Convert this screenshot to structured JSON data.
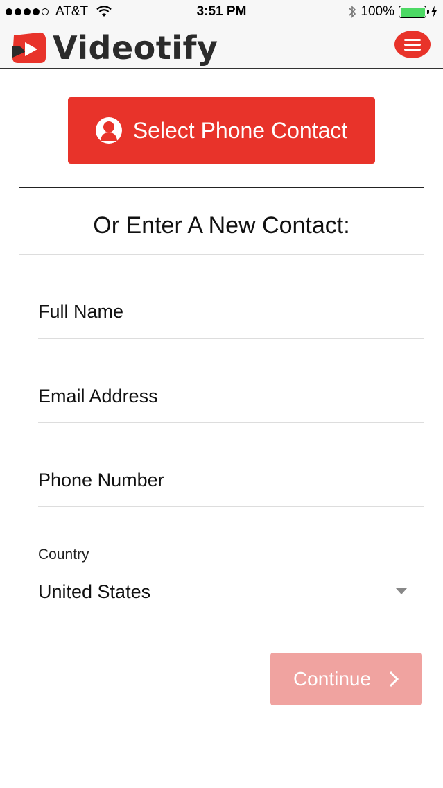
{
  "status_bar": {
    "carrier": "AT&T",
    "time": "3:51 PM",
    "battery": "100%"
  },
  "header": {
    "app_name": "Videotify"
  },
  "actions": {
    "select_contact_label": "Select Phone Contact"
  },
  "form": {
    "heading": "Or Enter A New Contact:",
    "full_name_placeholder": "Full Name",
    "email_placeholder": "Email Address",
    "phone_placeholder": "Phone Number",
    "country_label": "Country",
    "country_value": "United States",
    "continue_label": "Continue"
  },
  "colors": {
    "accent": "#e8332a",
    "continue_disabled": "#f0a3a0",
    "battery": "#4cd964"
  }
}
